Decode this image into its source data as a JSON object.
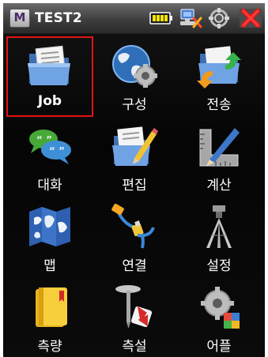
{
  "window": {
    "logo_letter": "M",
    "title": "TEST2"
  },
  "status": {
    "battery_icon": "battery-icon",
    "network_icon": "network-icon",
    "gps_icon": "gps-icon",
    "close_icon": "close-icon"
  },
  "menu": {
    "selected": "Job",
    "items": [
      {
        "label": "Job",
        "icon": "folder-icon"
      },
      {
        "label": "구성",
        "icon": "globe-gear-icon"
      },
      {
        "label": "전송",
        "icon": "transfer-icon"
      },
      {
        "label": "대화",
        "icon": "chat-icon"
      },
      {
        "label": "편집",
        "icon": "edit-icon"
      },
      {
        "label": "계산",
        "icon": "calculate-icon"
      },
      {
        "label": "맵",
        "icon": "map-icon"
      },
      {
        "label": "연결",
        "icon": "cable-icon"
      },
      {
        "label": "설정",
        "icon": "tripod-icon"
      },
      {
        "label": "측량",
        "icon": "notebook-icon"
      },
      {
        "label": "측설",
        "icon": "stakeout-icon"
      },
      {
        "label": "어플",
        "icon": "apps-icon"
      }
    ]
  }
}
